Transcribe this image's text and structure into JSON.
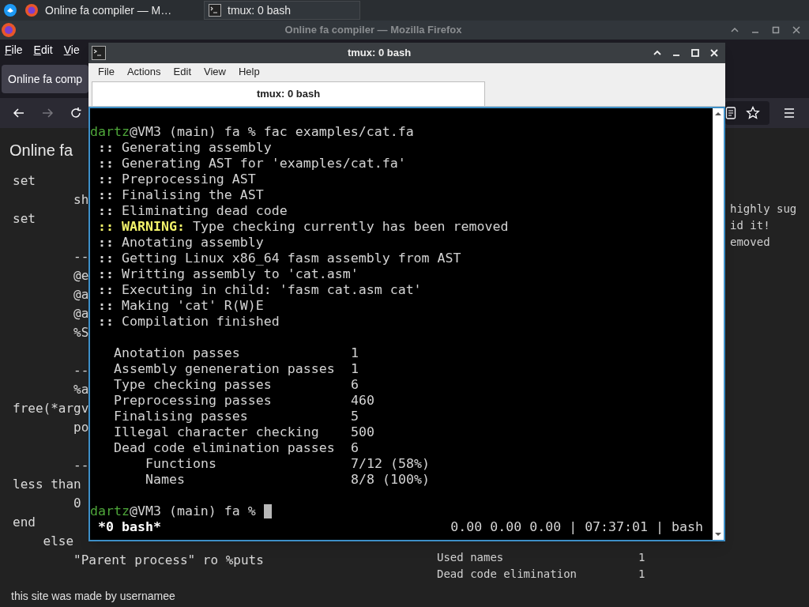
{
  "taskbar": {
    "tasks": [
      {
        "kind": "browser",
        "label": "Online fa compiler — M…",
        "selected": false
      },
      {
        "kind": "terminal",
        "label": "tmux: 0 bash",
        "selected": true
      }
    ]
  },
  "browser": {
    "title": "Online fa compiler — Mozilla Firefox",
    "menu": [
      "File",
      "Edit",
      "Vie"
    ],
    "tab": "Online fa comp",
    "page": {
      "heading": "Online fa",
      "code_lines": [
        {
          "kind": "code",
          "text": "set"
        },
        {
          "kind": "code",
          "text": "        sh"
        },
        {
          "kind": "code",
          "text": "set"
        },
        {
          "kind": "blank"
        },
        {
          "kind": "code",
          "text": "        --"
        },
        {
          "kind": "code",
          "text": "        @e"
        },
        {
          "kind": "code",
          "text": "        @a"
        },
        {
          "kind": "code",
          "text": "        @a"
        },
        {
          "kind": "code",
          "text": "        %S"
        },
        {
          "kind": "blank"
        },
        {
          "kind": "code",
          "text": "        --"
        },
        {
          "kind": "code",
          "text": "        %a"
        },
        {
          "kind": "code",
          "text": "free(*argv"
        },
        {
          "kind": "code",
          "text": "        po"
        },
        {
          "kind": "blank"
        },
        {
          "kind": "code",
          "text": "        --"
        },
        {
          "kind": "code",
          "text": "less than"
        },
        {
          "kind": "code",
          "text": "        0"
        },
        {
          "kind": "code",
          "text": "end"
        },
        {
          "kind": "code",
          "text": "    else"
        },
        {
          "kind": "code",
          "text": "        \"Parent process\" ro %puts"
        }
      ],
      "output_top": [
        "highly sug",
        "id it!",
        "emoved"
      ],
      "output_rows": [
        {
          "label": "Used names",
          "value": "1"
        },
        {
          "label": "Dead code elimination",
          "value": "1"
        }
      ],
      "footer": "this site was made by usernamee"
    }
  },
  "terminal": {
    "title": "tmux: 0 bash",
    "menu": [
      "File",
      "Actions",
      "Edit",
      "View",
      "Help"
    ],
    "tabs": [
      {
        "label": "tmux: 0 bash",
        "selected": true
      }
    ],
    "lines": [
      {
        "kind": "prompt",
        "user": "dartz",
        "rest": "@VM3 (main) fa %",
        "command": "fac examples/cat.fa"
      },
      {
        "kind": "step",
        "marker": "::",
        "text": "Generating assembly"
      },
      {
        "kind": "step",
        "marker": "::",
        "text": "Generating AST for 'examples/cat.fa'"
      },
      {
        "kind": "step",
        "marker": "::",
        "text": "Preprocessing AST"
      },
      {
        "kind": "step",
        "marker": "::",
        "text": "Finalising the AST"
      },
      {
        "kind": "step",
        "marker": "::",
        "text": "Eliminating dead code"
      },
      {
        "kind": "warning",
        "marker": "::",
        "label": "WARNING:",
        "text": "Type checking currently has been removed"
      },
      {
        "kind": "step",
        "marker": "::",
        "text": "Anotating assembly"
      },
      {
        "kind": "step",
        "marker": "::",
        "text": "Getting Linux x86_64 fasm assembly from AST"
      },
      {
        "kind": "step",
        "marker": "::",
        "text": "Writting assembly to 'cat.asm'"
      },
      {
        "kind": "step",
        "marker": "::",
        "text": "Executing in child: 'fasm cat.asm cat'"
      },
      {
        "kind": "step",
        "marker": "::",
        "text": "Making 'cat' R(W)E"
      },
      {
        "kind": "step",
        "marker": "::",
        "text": "Compilation finished"
      },
      {
        "kind": "blank"
      },
      {
        "kind": "stat",
        "label": "Anotation passes",
        "value": "1"
      },
      {
        "kind": "stat",
        "label": "Assembly geneneration passes",
        "value": "1"
      },
      {
        "kind": "stat",
        "label": "Type checking passes",
        "value": "6"
      },
      {
        "kind": "stat",
        "label": "Preprocessing passes",
        "value": "460"
      },
      {
        "kind": "stat",
        "label": "Finalising passes",
        "value": "5"
      },
      {
        "kind": "stat",
        "label": "Illegal character checking",
        "value": "500"
      },
      {
        "kind": "stat",
        "label": "Dead code elimination passes",
        "value": "6",
        "children": [
          {
            "label": "Functions",
            "value": "7/12 (58%)"
          },
          {
            "label": "Names",
            "value": "8/8 (100%)"
          }
        ]
      },
      {
        "kind": "blank"
      },
      {
        "kind": "prompt",
        "user": "dartz",
        "rest": "@VM3 (main) fa %",
        "cursor": true
      }
    ],
    "status": {
      "window": "*0 bash*",
      "right": "0.00 0.00 0.00 | 07:37:01 | bash"
    }
  }
}
